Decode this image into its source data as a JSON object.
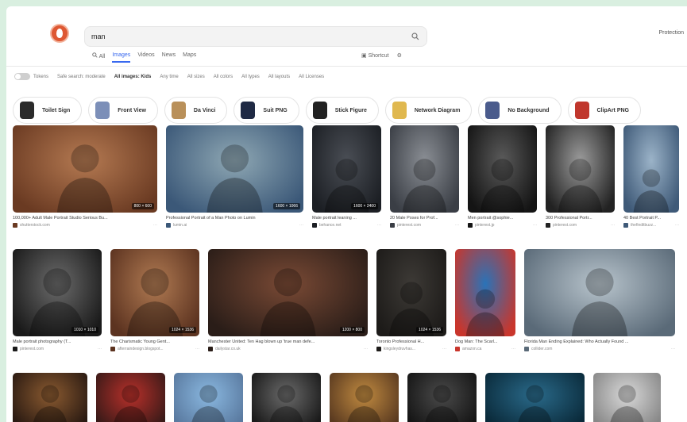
{
  "search": {
    "query": "man",
    "placeholder": ""
  },
  "header": {
    "protection": "Protection"
  },
  "tabs": [
    {
      "label": "All",
      "active": false
    },
    {
      "label": "Images",
      "active": true
    },
    {
      "label": "Videos",
      "active": false
    },
    {
      "label": "News",
      "active": false
    },
    {
      "label": "Maps",
      "active": false
    }
  ],
  "tabs_right": {
    "shortcut": "Shortcut"
  },
  "filters": {
    "toggle_label": "Tokens",
    "items": [
      "Safe search: moderate",
      "All images: Kids",
      "Any time",
      "All sizes",
      "All colors",
      "All types",
      "All layouts",
      "All Licenses"
    ]
  },
  "chips": [
    {
      "label": "Toilet Sign",
      "color": "#2b2b2b"
    },
    {
      "label": "Front View",
      "color": "#7c8fb8"
    },
    {
      "label": "Da Vinci",
      "color": "#b9905a"
    },
    {
      "label": "Suit PNG",
      "color": "#1f2a44"
    },
    {
      "label": "Stick Figure",
      "color": "#222222"
    },
    {
      "label": "Network Diagram",
      "color": "#e0b84f"
    },
    {
      "label": "No Background",
      "color": "#4a5b8c"
    },
    {
      "label": "ClipArt PNG",
      "color": "#c0362c"
    }
  ],
  "row1": [
    {
      "dim": "800 × 600",
      "caption": "100,000+ Adult Male Portrait Studio Serious Bu...",
      "source": "shutterstock.com",
      "c1": "#b57a52",
      "c2": "#6a3a22"
    },
    {
      "dim": "1600 × 1066",
      "caption": "Professional Portrait of a Man Photo on Lumin",
      "source": "lumin.ai",
      "c1": "#8fa8b4",
      "c2": "#3b5878"
    },
    {
      "dim": "1600 × 2400",
      "caption": "Male portrait leaning ...",
      "source": "behance.net",
      "c1": "#4a4e55",
      "c2": "#1c1f24"
    },
    {
      "dim": "",
      "caption": "20 Male Poses for Prof...",
      "source": "pinterest.com",
      "c1": "#8a8e94",
      "c2": "#3a3e45"
    },
    {
      "dim": "",
      "caption": "Men portrait @sophie...",
      "source": "pinterest.jp",
      "c1": "#5a5a5a",
      "c2": "#141414"
    },
    {
      "dim": "",
      "caption": "300 Professional Portr...",
      "source": "pinterest.com",
      "c1": "#9a9a9a",
      "c2": "#222222"
    },
    {
      "dim": "",
      "caption": "40 Best Portrait P...",
      "source": "thefinditbuzz...",
      "c1": "#9bb3c8",
      "c2": "#3f5a78"
    }
  ],
  "row2": [
    {
      "dim": "1010 × 1010",
      "caption": "Male portrait photography (T...",
      "source": "pinterest.com",
      "c1": "#6b6b6b",
      "c2": "#1a1a1a"
    },
    {
      "dim": "1024 × 1536",
      "caption": "The Charismatic Young Gent...",
      "source": "afterraindesign.blogspot...",
      "c1": "#b07a52",
      "c2": "#5c3320"
    },
    {
      "dim": "1200 × 800",
      "caption": "Manchester United: Ten Hag blown up 'true man defe...",
      "source": "dailystar.co.uk",
      "c1": "#7a4a35",
      "c2": "#2a1d18"
    },
    {
      "dim": "1024 × 1536",
      "caption": "Toronto Professional H...",
      "source": "kingsleydruvhas...",
      "c1": "#3d3a36",
      "c2": "#1d1b19"
    },
    {
      "dim": "",
      "caption": "Dog Man: The Scarl...",
      "source": "amazon.ca",
      "c1": "#2a73b8",
      "c2": "#c9362c"
    },
    {
      "dim": "",
      "caption": "Florida Man Ending Explained: Who Actually Found ...",
      "source": "collider.com",
      "c1": "#b8c4cc",
      "c2": "#5a6a78"
    }
  ],
  "row3": [
    {
      "c1": "#8a5a30",
      "c2": "#2a1a12"
    },
    {
      "c1": "#b8302a",
      "c2": "#3a1a18"
    },
    {
      "c1": "#8ab8e0",
      "c2": "#5a7aa0"
    },
    {
      "c1": "#6a6a6a",
      "c2": "#1a1a1a"
    },
    {
      "c1": "#c08a40",
      "c2": "#5a3a20"
    },
    {
      "c1": "#4a4a4a",
      "c2": "#151515"
    },
    {
      "c1": "#2a6a8a",
      "c2": "#0a2a3a"
    },
    {
      "c1": "#d8d8d8",
      "c2": "#888888"
    }
  ]
}
